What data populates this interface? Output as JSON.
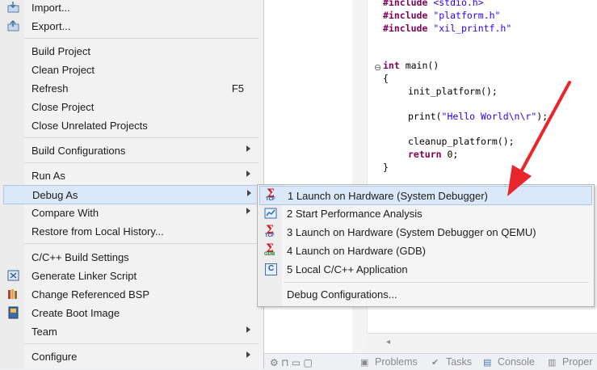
{
  "editor": {
    "lines": [
      "#include <stdio.h>",
      "#include \"platform.h\"",
      "#include \"xil_printf.h\"",
      "int main()",
      "{",
      "init_platform();",
      "print(\"Hello World\\n\\r\");",
      "cleanup_platform();",
      "return 0;",
      "}"
    ]
  },
  "context_menu": {
    "items": [
      {
        "label": "Import..."
      },
      {
        "label": "Export..."
      },
      {
        "label": "Build Project"
      },
      {
        "label": "Clean Project"
      },
      {
        "label": "Refresh",
        "shortcut": "F5"
      },
      {
        "label": "Close Project"
      },
      {
        "label": "Close Unrelated Projects"
      },
      {
        "label": "Build Configurations"
      },
      {
        "label": "Run As"
      },
      {
        "label": "Debug As"
      },
      {
        "label": "Compare With"
      },
      {
        "label": "Restore from Local History..."
      },
      {
        "label": "C/C++ Build Settings"
      },
      {
        "label": "Generate Linker Script"
      },
      {
        "label": "Change Referenced BSP"
      },
      {
        "label": "Create Boot Image"
      },
      {
        "label": "Team"
      },
      {
        "label": "Configure"
      }
    ]
  },
  "debug_submenu": {
    "items": [
      {
        "label": "1 Launch on Hardware (System Debugger)",
        "icon": "tcf-launch-icon"
      },
      {
        "label": "2 Start Performance Analysis",
        "icon": "performance-analysis-icon"
      },
      {
        "label": "3 Launch on Hardware (System Debugger on QEMU)",
        "icon": "tcf-launch-icon"
      },
      {
        "label": "4 Launch on Hardware (GDB)",
        "icon": "gdb-launch-icon"
      },
      {
        "label": "5 Local C/C++ Application",
        "icon": "c-application-icon"
      },
      {
        "label": "Debug Configurations..."
      }
    ]
  },
  "icon_text": {
    "tcf": "TCF",
    "gdb": "GDB",
    "c": "C"
  },
  "bottom_tabs": [
    "Problems",
    "Tasks",
    "Console",
    "Proper"
  ],
  "colors": {
    "highlight": "#dbe8f8",
    "highlight_border": "#a9c7ec",
    "annotation_arrow": "#e8262b",
    "keyword": "#7f0055",
    "string": "#2a00ff"
  }
}
